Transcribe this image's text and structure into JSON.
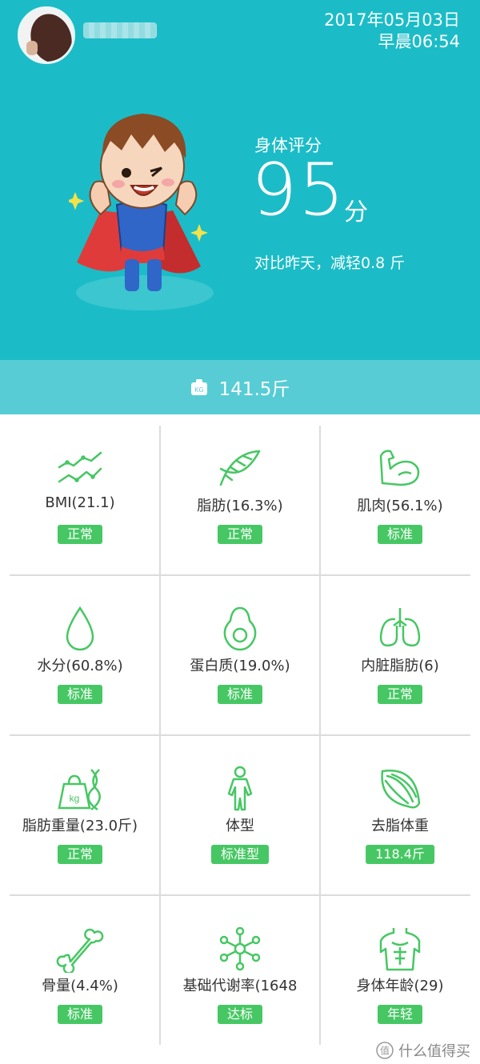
{
  "header": {
    "date": "2017年05月03日",
    "time": "早晨06:54"
  },
  "score": {
    "label": "身体评分",
    "value": "95",
    "unit": "分",
    "compare": "对比昨天，减轻0.8 斤"
  },
  "weight": {
    "value": "141.5斤",
    "icon": "kg-weight-icon"
  },
  "metrics": [
    {
      "label": "BMI(21.1)",
      "badge": "正常",
      "icon": "trend-lines-icon"
    },
    {
      "label": "脂肪(16.3%)",
      "badge": "正常",
      "icon": "dna-icon"
    },
    {
      "label": "肌肉(56.1%)",
      "badge": "标准",
      "icon": "biceps-icon"
    },
    {
      "label": "水分(60.8%)",
      "badge": "标准",
      "icon": "water-drop-icon"
    },
    {
      "label": "蛋白质(19.0%)",
      "badge": "标准",
      "icon": "avocado-icon"
    },
    {
      "label": "内脏脂肪(6)",
      "badge": "正常",
      "icon": "lungs-icon"
    },
    {
      "label": "脂肪重量(23.0斤)",
      "badge": "正常",
      "icon": "kg-dna-icon"
    },
    {
      "label": "体型",
      "badge": "标准型",
      "icon": "body-figure-icon"
    },
    {
      "label": "去脂体重",
      "badge": "118.4斤",
      "icon": "muscle-fiber-icon"
    },
    {
      "label": "骨量(4.4%)",
      "badge": "标准",
      "icon": "bone-icon"
    },
    {
      "label": "基础代谢率(1648",
      "badge": "达标",
      "icon": "molecule-icon"
    },
    {
      "label": "身体年龄(29)",
      "badge": "年轻",
      "icon": "torso-icon"
    }
  ],
  "watermark": {
    "text": "什么值得买",
    "icon": "zhi-logo-icon"
  },
  "colors": {
    "header_bg": "#1bbcc7",
    "weight_bar_bg": "#57ccd5",
    "badge_green": "#47c764",
    "icon_green": "#47c764"
  }
}
